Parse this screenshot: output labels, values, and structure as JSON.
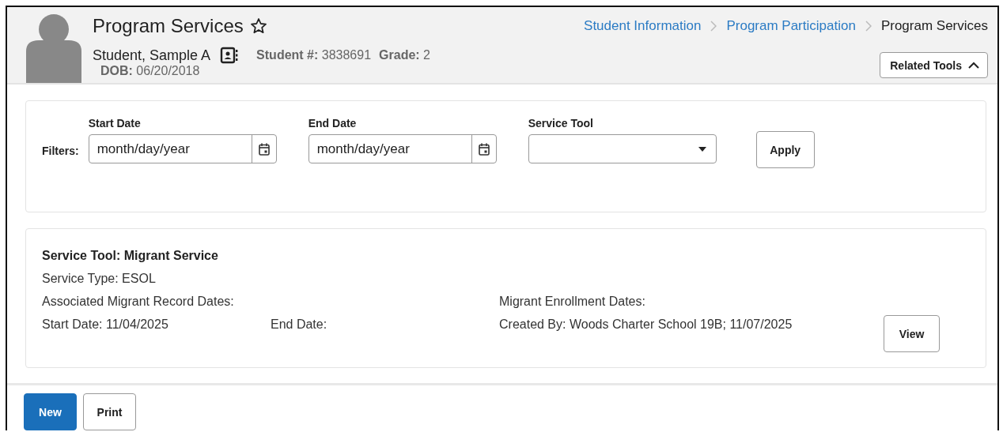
{
  "header": {
    "title": "Program Services",
    "favorite": false,
    "student": {
      "name": "Student, Sample A",
      "number_label": "Student #:",
      "number": "3838691",
      "grade_label": "Grade:",
      "grade": "2",
      "dob_label": "DOB:",
      "dob": "06/20/2018"
    },
    "breadcrumbs": [
      {
        "label": "Student Information",
        "current": false
      },
      {
        "label": "Program Participation",
        "current": false
      },
      {
        "label": "Program Services",
        "current": true
      }
    ],
    "related_tools": {
      "label": "Related Tools",
      "expanded": true
    }
  },
  "filters": {
    "label": "Filters:",
    "fields": [
      {
        "kind": "date",
        "label": "Start Date",
        "placeholder": "month/day/year"
      },
      {
        "kind": "date",
        "label": "End Date",
        "placeholder": "month/day/year"
      },
      {
        "kind": "select",
        "label": "Service Tool"
      }
    ],
    "apply": "Apply"
  },
  "record": {
    "title": "Service Tool: Migrant Service",
    "service_type": "Service Type: ESOL",
    "rows": [
      [
        "Associated Migrant Record Dates:",
        "",
        "Migrant Enrollment Dates:"
      ],
      [
        "Start Date: 11/04/2025",
        "End Date:",
        "Created By: Woods Charter School 19B; 11/07/2025"
      ]
    ],
    "view": "View"
  },
  "footer": {
    "buttons": [
      {
        "label": "New",
        "primary": true
      },
      {
        "label": "Print",
        "primary": false
      }
    ]
  }
}
